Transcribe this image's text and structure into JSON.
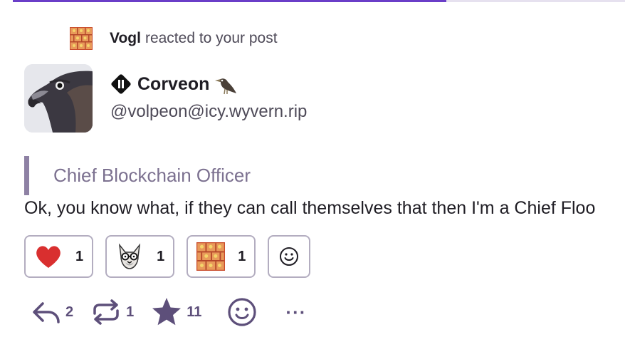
{
  "progress": {
    "fraction": 0.708
  },
  "notification": {
    "actor": "Vogl",
    "text": "reacted to your post"
  },
  "author": {
    "display_name": "Corveon",
    "handle": "@volpeon@icy.wyvern.rip"
  },
  "post": {
    "quote": "Chief Blockchain Officer",
    "body": "Ok, you know what, if they can call themselves that then I'm a Chief Floo"
  },
  "reactions": [
    {
      "emoji": "heart-emoji",
      "count": "1"
    },
    {
      "emoji": "fox-nerd-emoji",
      "count": "1"
    },
    {
      "emoji": "brick-wall-emoji",
      "count": "1"
    }
  ],
  "actions": {
    "replies": "2",
    "boosts": "1",
    "favourites": "11",
    "more": "···"
  },
  "colors": {
    "accent": "#6a3ec8",
    "quote_bar": "#8e81a4",
    "icon": "#5d4f7a",
    "border": "#b3adc0"
  }
}
